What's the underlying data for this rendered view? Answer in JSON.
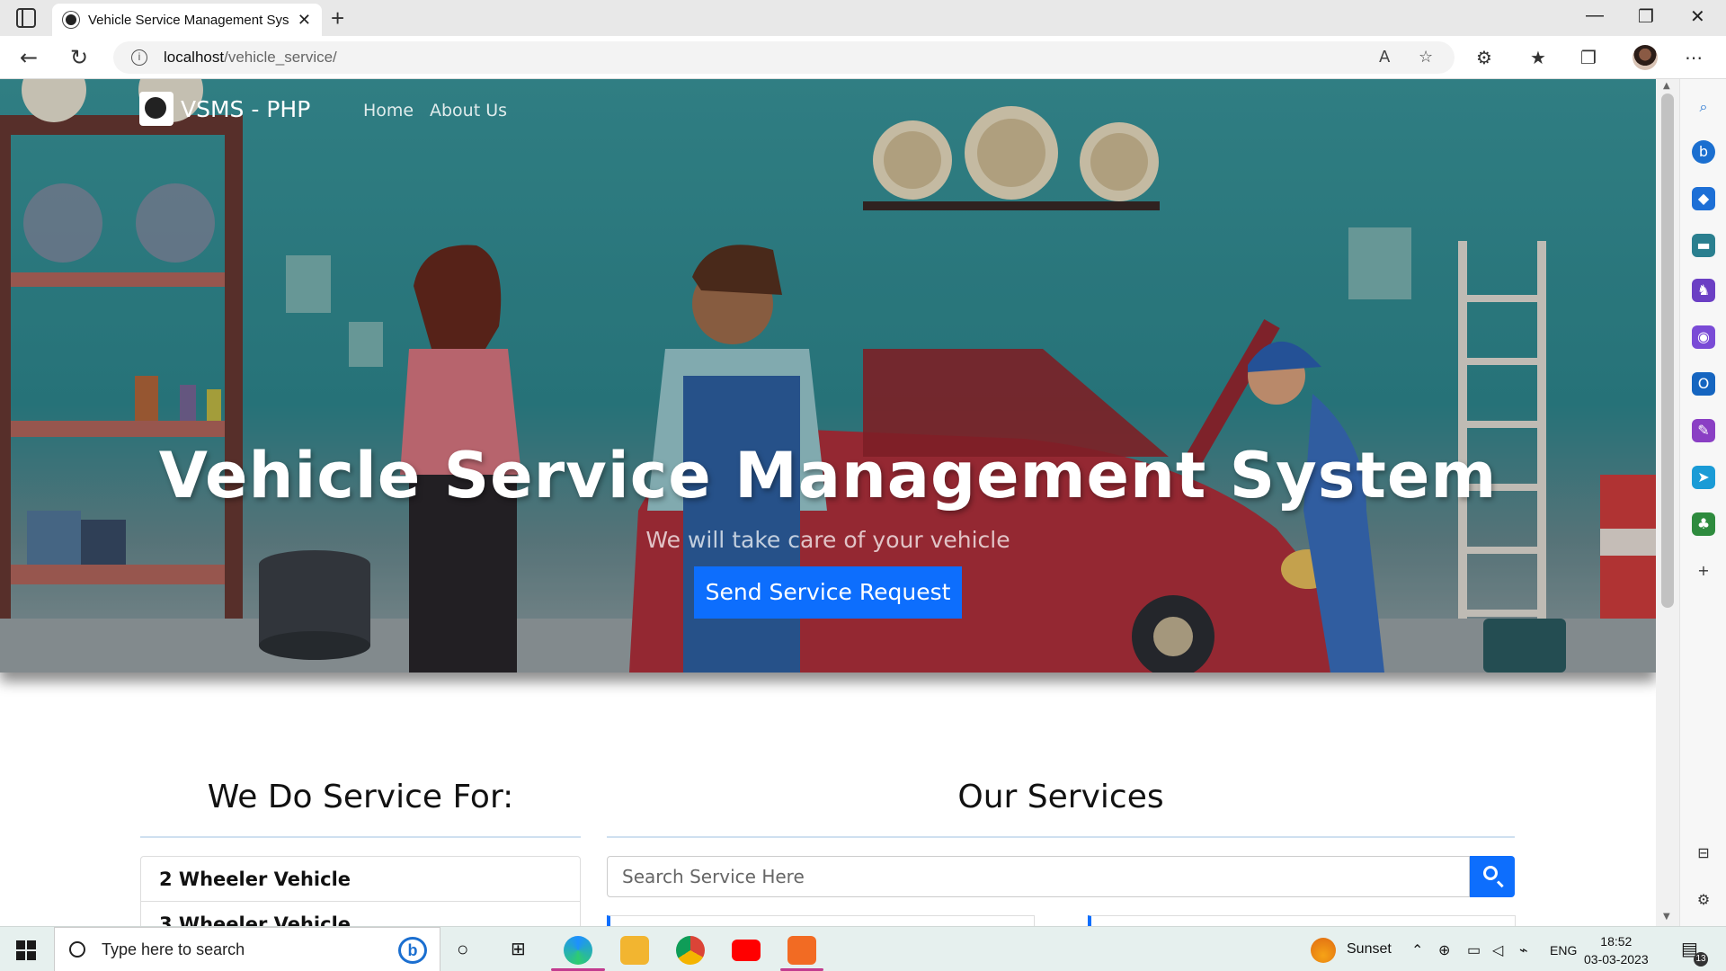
{
  "browser": {
    "tab_title": "Vehicle Service Management Sys",
    "new_tab": "+",
    "url_host": "localhost",
    "url_path": "/vehicle_service/",
    "controls": {
      "minimize": "—",
      "maximize": "❐",
      "close": "✕"
    }
  },
  "site": {
    "brand": "VSMS - PHP",
    "nav": [
      "Home",
      "About Us"
    ],
    "hero_title": "Vehicle Service Management System",
    "hero_subtitle": "We will take care of your vehicle",
    "hero_button": "Send Service Request"
  },
  "service_for": {
    "title": "We Do Service For:",
    "items": [
      "2 Wheeler Vehicle",
      "3 Wheeler Vehicle"
    ]
  },
  "our_services": {
    "title": "Our Services",
    "search_placeholder": "Search Service Here"
  },
  "taskbar": {
    "search_placeholder": "Type here to search",
    "weather": "Sunset",
    "language": "ENG",
    "time": "18:52",
    "date": "03-03-2023",
    "notification_count": "13"
  },
  "colors": {
    "primary": "#0d6efd",
    "hero_teal": "#2f8c93"
  }
}
